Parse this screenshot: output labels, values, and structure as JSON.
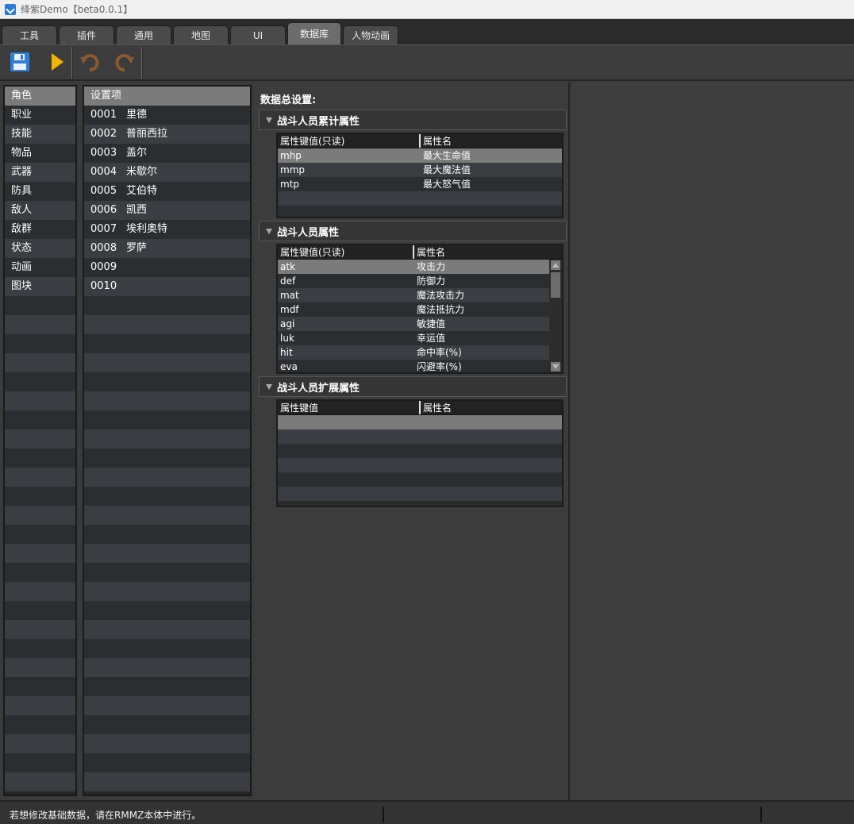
{
  "window": {
    "title": "绛紫Demo【beta0.0.1】"
  },
  "tabs": [
    {
      "label": "工具"
    },
    {
      "label": "插件"
    },
    {
      "label": "通用"
    },
    {
      "label": "地图"
    },
    {
      "label": "UI"
    },
    {
      "label": "数据库",
      "active": true
    },
    {
      "label": "人物动画"
    }
  ],
  "toolbar": {
    "icons": [
      "save-icon",
      "play-icon",
      "undo-icon",
      "redo-icon"
    ],
    "colors": {
      "save": "#3d8fe0",
      "play": "#f2b400",
      "undo": "#9a6a3a",
      "redo": "#9a6a3a"
    }
  },
  "categories": [
    "角色",
    "职业",
    "技能",
    "物品",
    "武器",
    "防具",
    "敌人",
    "敌群",
    "状态",
    "动画",
    "图块"
  ],
  "settings": {
    "header": "设置项",
    "items": [
      {
        "id": "0001",
        "name": "里德"
      },
      {
        "id": "0002",
        "name": "普丽西拉"
      },
      {
        "id": "0003",
        "name": "盖尔"
      },
      {
        "id": "0004",
        "name": "米歇尔"
      },
      {
        "id": "0005",
        "name": "艾伯特"
      },
      {
        "id": "0006",
        "name": "凯西"
      },
      {
        "id": "0007",
        "name": "埃利奥特"
      },
      {
        "id": "0008",
        "name": "罗萨"
      },
      {
        "id": "0009",
        "name": ""
      },
      {
        "id": "0010",
        "name": ""
      }
    ]
  },
  "content": {
    "title": "数据总设置:",
    "groups": [
      {
        "title": "战斗人员累计属性",
        "col_key": "属性键值(只读)",
        "col_name": "属性名",
        "rows": [
          {
            "key": "mhp",
            "name": "最大生命值"
          },
          {
            "key": "mmp",
            "name": "最大魔法值"
          },
          {
            "key": "mtp",
            "name": "最大怒气值"
          }
        ]
      },
      {
        "title": "战斗人员属性",
        "col_key": "属性键值(只读)",
        "col_name": "属性名",
        "rows": [
          {
            "key": "atk",
            "name": "攻击力"
          },
          {
            "key": "def",
            "name": "防御力"
          },
          {
            "key": "mat",
            "name": "魔法攻击力"
          },
          {
            "key": "mdf",
            "name": "魔法抵抗力"
          },
          {
            "key": "agi",
            "name": "敏捷值"
          },
          {
            "key": "luk",
            "name": "幸运值"
          },
          {
            "key": "hit",
            "name": "命中率(%)"
          },
          {
            "key": "eva",
            "name": "闪避率(%)"
          }
        ]
      },
      {
        "title": "战斗人员扩展属性",
        "col_key": "属性键值",
        "col_name": "属性名",
        "rows": []
      }
    ]
  },
  "status": {
    "text": "若想修改基础数据，请在RMMZ本体中进行。"
  }
}
